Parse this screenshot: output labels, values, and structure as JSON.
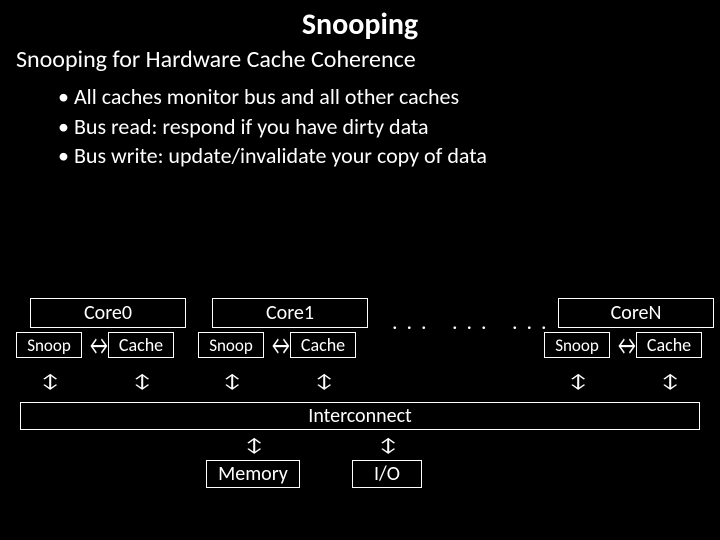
{
  "title": "Snooping",
  "subtitle": "Snooping for Hardware Cache Coherence",
  "bullets": [
    "All caches monitor bus and all other caches",
    "Bus read: respond if you have dirty data",
    "Bus write: update/invalidate your copy of data"
  ],
  "diagram": {
    "cores": [
      "Core0",
      "Core1",
      "CoreN"
    ],
    "snoop_label": "Snoop",
    "cache_label": "Cache",
    "interconnect": "Interconnect",
    "memory": "Memory",
    "io": "I/O",
    "ellipsis": ". . ."
  }
}
